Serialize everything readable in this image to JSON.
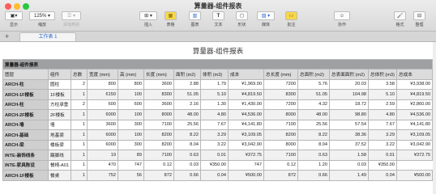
{
  "window": {
    "title": "算量器-组件报表",
    "traffic_colors": [
      "#ff5f57",
      "#febc2e",
      "#28c840"
    ]
  },
  "toolbar": {
    "left": [
      {
        "id": "view",
        "label": "显示",
        "button": "▣▾"
      },
      {
        "id": "zoom",
        "label": "缩放",
        "button": "125% ▾"
      },
      {
        "id": "add-category",
        "label": "添加类别",
        "button": "☰ ▾"
      }
    ],
    "center": [
      {
        "id": "insert",
        "label": "插入",
        "button": "⊞ ▾"
      },
      {
        "id": "table",
        "label": "表格",
        "button": "▦"
      },
      {
        "id": "chart",
        "label": "图表",
        "button": "▥"
      },
      {
        "id": "text",
        "label": "文本",
        "button": "T"
      },
      {
        "id": "shape",
        "label": "形状",
        "button": "◻"
      },
      {
        "id": "media",
        "label": "媒体",
        "button": "▨ ▾"
      },
      {
        "id": "comment",
        "label": "批注",
        "button": "▭"
      }
    ],
    "collaborate": {
      "label": "协作",
      "button": "☺"
    },
    "right": [
      {
        "id": "format",
        "label": "格式",
        "button": "🖌"
      },
      {
        "id": "organize",
        "label": "整理",
        "button": "⊟"
      }
    ]
  },
  "tabs": {
    "add_label": "+",
    "active": "工作表 1"
  },
  "sheet": {
    "title": "算量器-组件报表",
    "table_title": "算量器-组件报表",
    "columns": [
      "图层",
      "组件",
      "总数",
      "宽度 (mm)",
      "高 (mm)",
      "长度 (mm)",
      "面积 (m2)",
      "体积 (m3)",
      "成本",
      "总长度 (mm)",
      "总面积 (m2)",
      "总表面面积 (m2)",
      "总体积 (m3)",
      "总成本"
    ],
    "rows": [
      [
        "ARCH-柱",
        "圆柱",
        "2",
        "800",
        "800",
        "3600",
        "2.88",
        "1.79",
        "¥1,969.00",
        "7200",
        "5.76",
        "20.03",
        "3.58",
        "¥3,938.00"
      ],
      [
        "ARCH-1F楼板",
        "1F楼板",
        "1",
        "6150",
        "100",
        "8300",
        "51.05",
        "5.10",
        "¥4,819.50",
        "8300",
        "51.05",
        "104.98",
        "5.10",
        "¥4,819.50"
      ],
      [
        "ARCH-柱",
        "方柱承重",
        "2",
        "600",
        "600",
        "3600",
        "2.16",
        "1.30",
        "¥1,430.00",
        "7200",
        "4.32",
        "18.72",
        "2.59",
        "¥2,860.00"
      ],
      [
        "ARCH-2F楼板",
        "2F楼板",
        "1",
        "6000",
        "100",
        "8000",
        "48.00",
        "4.80",
        "¥4,536.00",
        "8000",
        "48.00",
        "98.80",
        "4.80",
        "¥4,536.00"
      ],
      [
        "ARCH-墙",
        "墙",
        "1",
        "3600",
        "300",
        "7100",
        "25.56",
        "7.67",
        "¥4,141.80",
        "7100",
        "25.56",
        "57.54",
        "7.67",
        "¥4,141.80"
      ],
      [
        "ARCH-基础",
        "地基梁",
        "1",
        "6000",
        "100",
        "8200",
        "8.22",
        "3.29",
        "¥3,109.05",
        "8200",
        "8.22",
        "38.36",
        "3.29",
        "¥3,109.05"
      ],
      [
        "ARCH-梁",
        "楼板梁",
        "1",
        "6000",
        "300",
        "8200",
        "8.04",
        "3.22",
        "¥3,042.90",
        "8000",
        "8.04",
        "37.52",
        "3.22",
        "¥3,042.90"
      ],
      [
        "INTE-装饰线条",
        "踢脚线",
        "1",
        "19",
        "89",
        "7100",
        "0.63",
        "0.01",
        "¥372.75",
        "7100",
        "0.63",
        "1.58",
        "0.01",
        "¥372.75"
      ],
      [
        "INTE-家具陈设",
        "餐椅-A01",
        "1",
        "470",
        "747",
        "0.12",
        "0.03",
        "¥350.00",
        "747",
        "0.12",
        "1.20",
        "0.03",
        "¥350.00"
      ],
      [
        "ARCH-1F楼板",
        "餐桌",
        "1",
        "752",
        "56",
        "872",
        "0.66",
        "0.04",
        "¥500.00",
        "872",
        "0.66",
        "1.49",
        "0.04",
        "¥500.00"
      ]
    ]
  }
}
